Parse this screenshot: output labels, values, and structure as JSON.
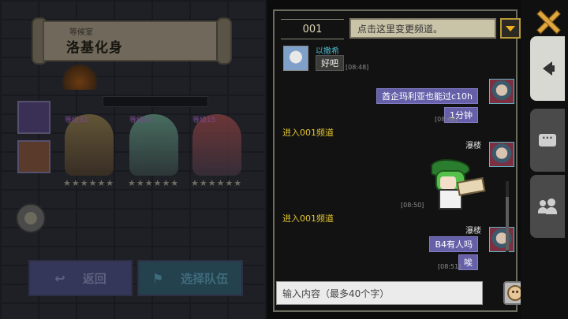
{
  "background": {
    "banner_small": "等候室",
    "banner_title": "洛基化身",
    "team_bar_label": "",
    "hero_levels": [
      "等级32",
      "等级25",
      "等级15"
    ],
    "stars": [
      "★★★★★★",
      "★★★★★★",
      "★★★★★★"
    ],
    "back_button": "返回",
    "team_button": "选择队伍"
  },
  "chat": {
    "channel_tab": "001",
    "channel_placeholder": "点击这里变更频道。",
    "messages": [
      {
        "side": "other",
        "name": "以撒希",
        "text": "好吧",
        "time": "[08:48]"
      },
      {
        "side": "me",
        "name": "",
        "text": "酋企玛利亚也能过c10h",
        "time": ""
      },
      {
        "side": "me",
        "name": "",
        "text": "1分钟",
        "time": "[08:48]"
      },
      {
        "side": "system",
        "text": "进入001频道"
      },
      {
        "side": "me",
        "name": "瀑楼",
        "sticker": true,
        "time": "[08:50]"
      },
      {
        "side": "system",
        "text": "进入001频道"
      },
      {
        "side": "me",
        "name": "瀑楼",
        "text": "B4有人吗",
        "time": ""
      },
      {
        "side": "me",
        "name": "",
        "text": "唉",
        "time": "[08:51]"
      }
    ],
    "my_name": "瀑楼",
    "input_placeholder": "输入内容（最多40个字）"
  },
  "icons": {
    "close": "close-icon",
    "announce": "speaker-icon",
    "chat": "chat-bubble-icon",
    "friends": "friends-icon",
    "emoji": "emoji-icon",
    "dropdown": "chevron-down-icon"
  },
  "colors": {
    "accent": "#f0b020",
    "my_bubble": "#6560a8",
    "system_text": "#e2c431",
    "name_other": "#4fb6c8"
  }
}
